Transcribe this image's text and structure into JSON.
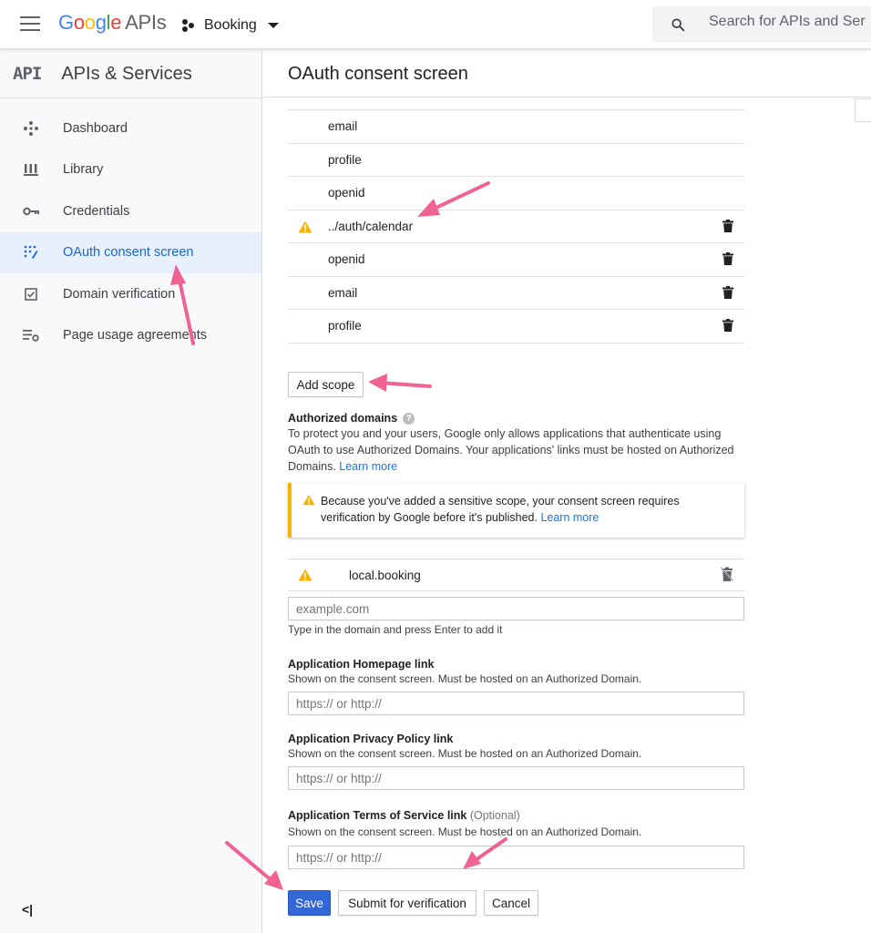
{
  "topbar": {
    "logo_google": "Google",
    "logo_apis": "APIs",
    "project_name": "Booking",
    "search_placeholder": "Search for APIs and Ser"
  },
  "sidebar": {
    "api_badge": "API",
    "title": "APIs & Services",
    "items": [
      {
        "label": "Dashboard",
        "icon": "dashboard-icon"
      },
      {
        "label": "Library",
        "icon": "library-icon"
      },
      {
        "label": "Credentials",
        "icon": "key-icon"
      },
      {
        "label": "OAuth consent screen",
        "icon": "oauth-icon",
        "active": true
      },
      {
        "label": "Domain verification",
        "icon": "checkbox-icon"
      },
      {
        "label": "Page usage agreements",
        "icon": "settings-list-icon"
      }
    ],
    "collapse_label": "<|"
  },
  "main": {
    "title": "OAuth consent screen",
    "scopes": [
      {
        "name": "email",
        "warning": false,
        "deletable": false
      },
      {
        "name": "profile",
        "warning": false,
        "deletable": false
      },
      {
        "name": "openid",
        "warning": false,
        "deletable": false
      },
      {
        "name": "../auth/calendar",
        "warning": true,
        "deletable": true
      },
      {
        "name": "openid",
        "warning": false,
        "deletable": true
      },
      {
        "name": "email",
        "warning": false,
        "deletable": true
      },
      {
        "name": "profile",
        "warning": false,
        "deletable": true
      }
    ],
    "add_scope_label": "Add scope",
    "authorized_domains": {
      "label": "Authorized domains",
      "help": "?",
      "description": "To protect you and your users, Google only allows applications that authenticate using OAuth to use Authorized Domains. Your applications' links must be hosted on Authorized Domains.",
      "learn_more": "Learn more",
      "notice": "Because you've added a sensitive scope, your consent screen requires verification by Google before it's published.",
      "notice_link": "Learn more",
      "domains": [
        "local.booking"
      ],
      "input_placeholder": "example.com",
      "input_hint": "Type in the domain and press Enter to add it"
    },
    "homepage": {
      "label": "Application Homepage link",
      "hint": "Shown on the consent screen. Must be hosted on an Authorized Domain.",
      "placeholder": "https:// or http://"
    },
    "privacy": {
      "label": "Application Privacy Policy link",
      "hint": "Shown on the consent screen. Must be hosted on an Authorized Domain.",
      "placeholder": "https:// or http://"
    },
    "terms": {
      "label": "Application Terms of Service link",
      "optional": "(Optional)",
      "hint": "Shown on the consent screen. Must be hosted on an Authorized Domain.",
      "placeholder": "https:// or http://"
    },
    "buttons": {
      "save": "Save",
      "submit": "Submit for verification",
      "cancel": "Cancel"
    }
  },
  "colors": {
    "accent": "#1a73e8",
    "primary_button": "#3367d6",
    "warning": "#f4b400",
    "annotation_arrow": "#f06292"
  }
}
